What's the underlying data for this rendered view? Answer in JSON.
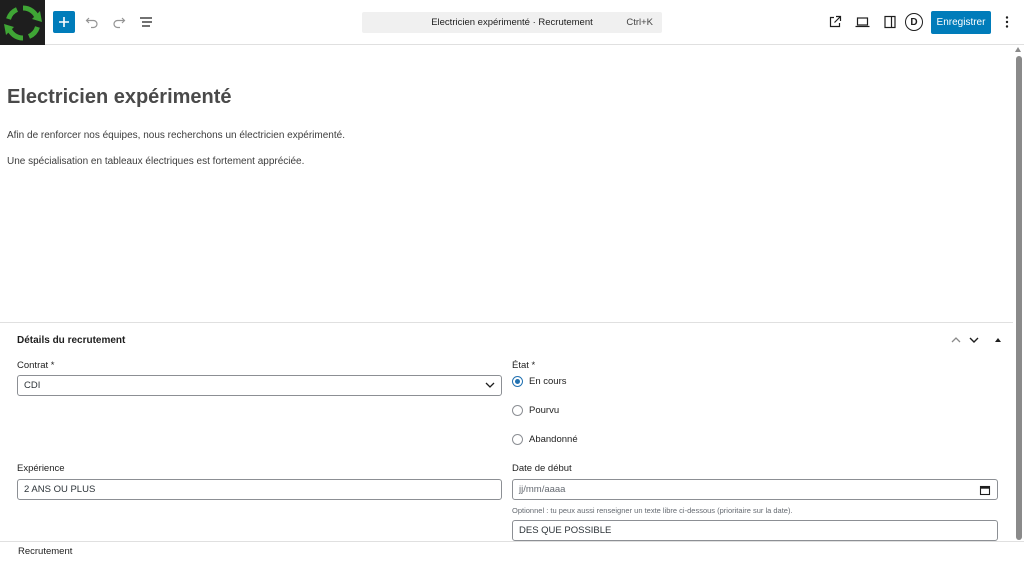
{
  "toolbar": {
    "document_title": "Electricien expérimenté · Recrutement",
    "shortcut": "Ctrl+K",
    "save_label": "Enregistrer",
    "divi_letter": "D",
    "accent_color": "#007cba"
  },
  "post": {
    "title": "Electricien expérimenté",
    "paragraphs": [
      "Afin de renforcer nos équipes, nous recherchons un électricien expérimenté.",
      "Une spécialisation en tableaux électriques est fortement appréciée."
    ]
  },
  "metabox": {
    "title": "Détails du recrutement",
    "contrat": {
      "label": "Contrat *",
      "value": "CDI"
    },
    "etat": {
      "label": "État *",
      "options": [
        {
          "label": "En cours",
          "checked": true
        },
        {
          "label": "Pourvu",
          "checked": false
        },
        {
          "label": "Abandonné",
          "checked": false
        }
      ]
    },
    "experience": {
      "label": "Expérience",
      "value": "2 ANS OU PLUS"
    },
    "date_debut": {
      "label": "Date de début",
      "placeholder": "jj/mm/aaaa",
      "help": "Optionnel : tu peux aussi renseigner un texte libre ci-dessous (prioritaire sur la date).",
      "free_text": "DES QUE POSSIBLE"
    }
  },
  "footer": {
    "breadcrumb": "Recrutement"
  },
  "icons": [
    "site-logo-icon",
    "plus-icon",
    "undo-icon",
    "redo-icon",
    "list-view-icon",
    "external-link-icon",
    "desktop-icon",
    "sidebar-icon",
    "divi-icon",
    "more-vertical-icon",
    "chevron-up-icon",
    "chevron-down-icon",
    "triangle-up-icon",
    "calendar-icon"
  ]
}
